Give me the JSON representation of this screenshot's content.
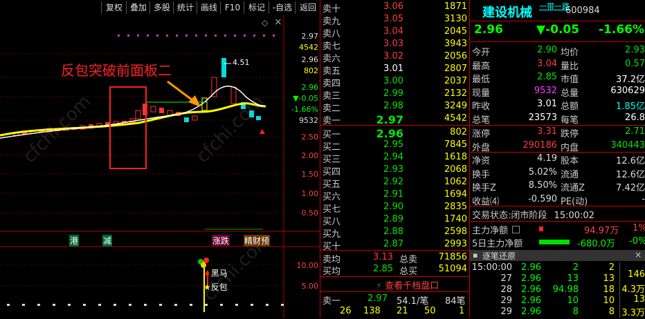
{
  "toolbar": [
    "复权",
    "叠加",
    "多股",
    "统计",
    "画线",
    "F10",
    "标记",
    "-自选",
    "返回"
  ],
  "chart": {
    "annotation": "反包突破前面板二",
    "watermark": "cfchi.com",
    "peak_label": "4.51",
    "price_axis": [
      "2.97",
      "4542",
      "2.96",
      "802",
      "2.96",
      "▼-0.05",
      "-1.66%",
      "9532",
      "2.50",
      "2.00",
      "1.50",
      "1.00",
      "0.50"
    ],
    "indicator_axis": [
      "10.00",
      "5.00"
    ],
    "signals": [
      "港",
      "减",
      "涨跌",
      "精财预"
    ],
    "markers": [
      "黑马",
      "反包"
    ],
    "collapse_glyph": "◇",
    "close_glyph": "×"
  },
  "book": {
    "sell": [
      {
        "label": "卖十",
        "price": "3.06",
        "vol": "1871",
        "color": "red"
      },
      {
        "label": "卖九",
        "price": "3.05",
        "vol": "3130",
        "color": "red"
      },
      {
        "label": "卖八",
        "price": "3.04",
        "vol": "2045",
        "color": "red"
      },
      {
        "label": "卖七",
        "price": "3.03",
        "vol": "3943",
        "color": "red"
      },
      {
        "label": "卖六",
        "price": "3.02",
        "vol": "2056",
        "color": "red"
      },
      {
        "label": "卖五",
        "price": "3.01",
        "vol": "2807",
        "color": "white"
      },
      {
        "label": "卖四",
        "price": "3.00",
        "vol": "2037",
        "color": "green"
      },
      {
        "label": "卖三",
        "price": "2.99",
        "vol": "2132",
        "color": "green"
      },
      {
        "label": "卖二",
        "price": "2.98",
        "vol": "3249",
        "color": "green"
      },
      {
        "label": "卖一",
        "price": "2.97",
        "vol": "4542",
        "color": "green"
      }
    ],
    "buy": [
      {
        "label": "买一",
        "price": "2.96",
        "vol": "802",
        "color": "green"
      },
      {
        "label": "买二",
        "price": "2.95",
        "vol": "7845",
        "color": "green"
      },
      {
        "label": "买三",
        "price": "2.94",
        "vol": "1618",
        "color": "green"
      },
      {
        "label": "买四",
        "price": "2.93",
        "vol": "2068",
        "color": "green"
      },
      {
        "label": "买五",
        "price": "2.92",
        "vol": "1062",
        "color": "green"
      },
      {
        "label": "买六",
        "price": "2.91",
        "vol": "1694",
        "color": "green"
      },
      {
        "label": "买七",
        "price": "2.90",
        "vol": "2835",
        "color": "green"
      },
      {
        "label": "买八",
        "price": "2.89",
        "vol": "1740",
        "color": "green"
      },
      {
        "label": "买九",
        "price": "2.88",
        "vol": "2598",
        "color": "green"
      },
      {
        "label": "买十",
        "price": "2.87",
        "vol": "2993",
        "color": "green"
      }
    ],
    "avg_sell_label": "卖均",
    "avg_sell": "3.13",
    "total_sell_label": "总卖",
    "total_sell": "71856",
    "avg_buy_label": "买均",
    "avg_buy": "2.85",
    "total_buy_label": "总买",
    "total_buy": "51094",
    "view_thousand": "查看千档盘口",
    "bottom": {
      "label": "卖一",
      "price": "2.97",
      "per": "54.1/笔",
      "count": "84笔",
      "nums": [
        "26",
        "138",
        "21",
        "50",
        "1"
      ]
    }
  },
  "info": {
    "name": "建设机械",
    "tag": "一带一路",
    "code": "600984",
    "price": "2.96",
    "change": "▼-0.05",
    "pct": "-1.66%",
    "rows": [
      {
        "l1": "今开",
        "v1": "2.90",
        "c1": "green",
        "l2": "均价",
        "v2": "2.93",
        "c2": "green"
      },
      {
        "l1": "最高",
        "v1": "3.04",
        "c1": "red",
        "l2": "量比",
        "v2": "0.57",
        "c2": "green"
      },
      {
        "l1": "最低",
        "v1": "2.85",
        "c1": "green",
        "l2": "市值",
        "v2": "37.2亿",
        "c2": "white"
      },
      {
        "l1": "现量",
        "v1": "9532",
        "c1": "magenta",
        "l2": "总量",
        "v2": "630629",
        "c2": "white"
      },
      {
        "l1": "昨收",
        "v1": "3.01",
        "c1": "white",
        "l2": "总额",
        "v2": "1.85亿",
        "c2": "cyan"
      },
      {
        "l1": "总笔",
        "v1": "23573",
        "c1": "white",
        "l2": "每笔",
        "v2": "26.8",
        "c2": "white"
      }
    ],
    "limit": [
      {
        "l1": "涨停",
        "v1": "3.31",
        "c1": "red",
        "l2": "跌停",
        "v2": "2.71",
        "c2": "green"
      },
      {
        "l1": "外盘",
        "v1": "290186",
        "c1": "red",
        "l2": "内盘",
        "v2": "340443",
        "c2": "green"
      }
    ],
    "stats": [
      {
        "l1": "净资",
        "v1": "4.19",
        "l2": "股本",
        "v2": "12.6亿"
      },
      {
        "l1": "换手",
        "v1": "5.02%",
        "l2": "流通",
        "v2": "12.6亿"
      },
      {
        "l1": "换手Z",
        "v1": "8.50%",
        "l2": "流通Z",
        "v2": "7.42亿"
      },
      {
        "l1": "收益⑷",
        "v1": "-0.590",
        "l2": "PE(动)",
        "v2": "-"
      }
    ],
    "status_label": "交易状态:",
    "status": "闭市阶段",
    "status_time": "15:00:02",
    "main_net_label": "主力净额",
    "main_net": "94.97万",
    "main_net_pct": "1%",
    "five_day_label": "5日主力净额",
    "five_day": "-680.0万",
    "five_day_pct": "-0%",
    "tick_title": "逐笔还原",
    "ticks": [
      {
        "t": "15:00:00",
        "p": "2.96",
        "v": "2",
        "n": "2"
      },
      {
        "t": "27",
        "p": "2.96",
        "v": "13",
        "n": "13"
      },
      {
        "t": "28",
        "p": "2.96",
        "v": "94.98",
        "n": "18"
      },
      {
        "t": "29",
        "p": "2.96",
        "v": "10",
        "n": "10"
      },
      {
        "t": "29",
        "p": "2.96",
        "v": "8",
        "n": "8"
      }
    ],
    "side_vals": [
      "146",
      "4.3万",
      "13",
      "3.3万"
    ]
  }
}
